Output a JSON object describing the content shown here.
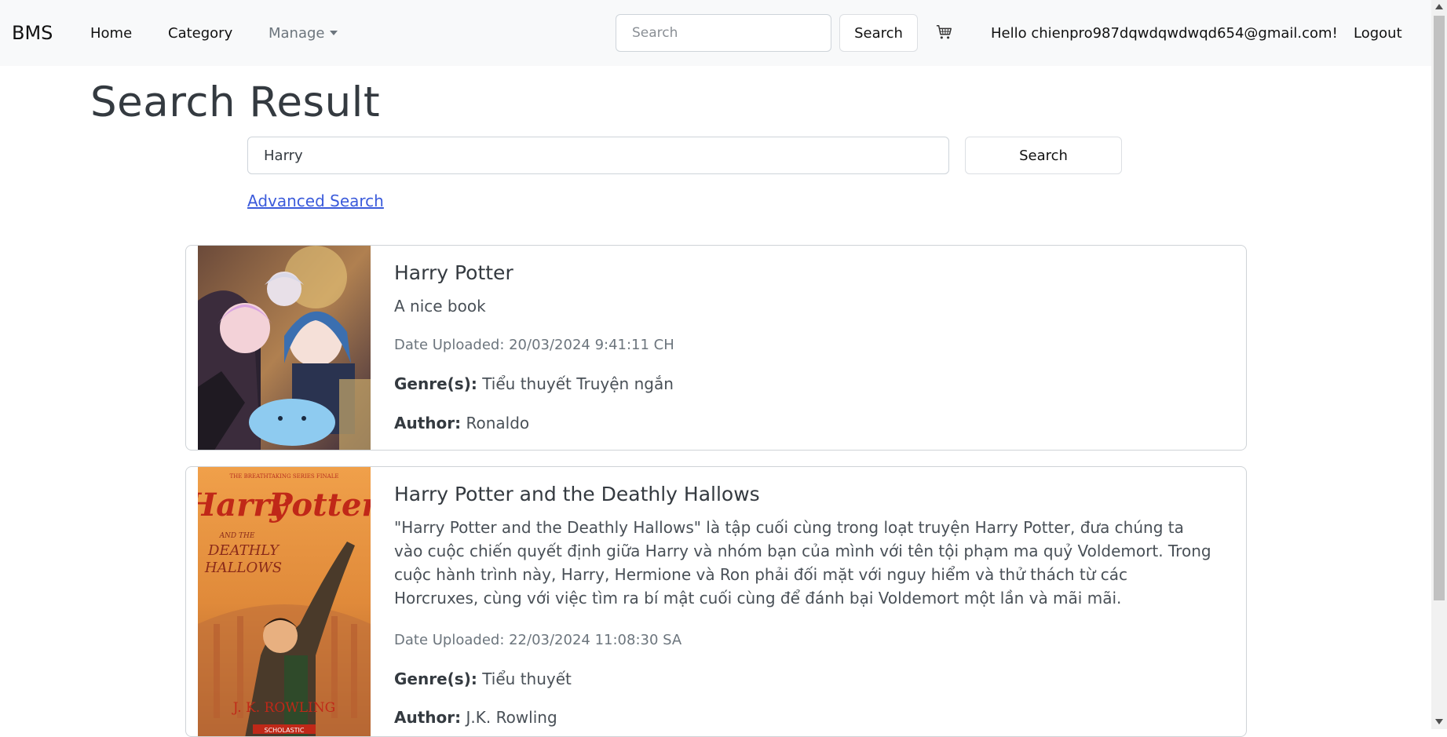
{
  "navbar": {
    "brand": "BMS",
    "home": "Home",
    "category": "Category",
    "manage": "Manage",
    "search_placeholder": "Search",
    "search_button": "Search",
    "cart_icon": "cart-icon",
    "greeting": "Hello chienpro987dqwdqwdwqd654@gmail.com!",
    "logout": "Logout"
  },
  "main": {
    "title": "Search Result",
    "search_value": "Harry",
    "search_button": "Search",
    "advanced_link": "Advanced Search"
  },
  "results": [
    {
      "title": "Harry Potter",
      "description": "A nice book",
      "date_uploaded": "Date Uploaded: 20/03/2024 9:41:11 CH",
      "genre_label": "Genre(s):",
      "genres": "Tiểu thuyết Truyện ngắn",
      "author_label": "Author:",
      "author": "Ronaldo"
    },
    {
      "title": "Harry Potter and the Deathly Hallows",
      "description": "\"Harry Potter and the Deathly Hallows\" là tập cuối cùng trong loạt truyện Harry Potter, đưa chúng ta vào cuộc chiến quyết định giữa Harry và nhóm bạn của mình với tên tội phạm ma quỷ Voldemort. Trong cuộc hành trình này, Harry, Hermione và Ron phải đối mặt với nguy hiểm và thử thách từ các Horcruxes, cùng với việc tìm ra bí mật cuối cùng để đánh bại Voldemort một lần và mãi mãi.",
      "date_uploaded": "Date Uploaded: 22/03/2024 11:08:30 SA",
      "genre_label": "Genre(s):",
      "genres": "Tiểu thuyết",
      "author_label": "Author:",
      "author": "J.K. Rowling",
      "cover_text": {
        "top": "THE BREATHTAKING SERIES FINALE",
        "harry": "Harry",
        "potter": "Potter",
        "and_the": "AND THE",
        "deathly": "DEATHLY",
        "hallows": "HALLOWS",
        "author": "J. K. ROWLING",
        "publisher": "SCHOLASTIC"
      }
    }
  ]
}
